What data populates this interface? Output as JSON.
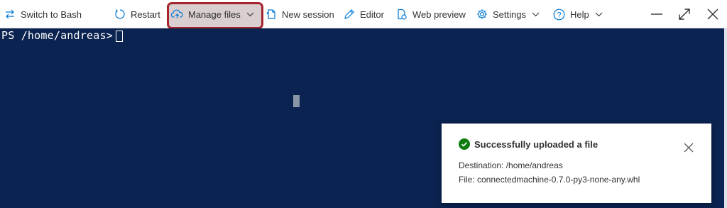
{
  "toolbar": {
    "switch_shell_label": "Switch to Bash",
    "restart_label": "Restart",
    "manage_files_label": "Manage files",
    "new_session_label": "New session",
    "editor_label": "Editor",
    "web_preview_label": "Web preview",
    "settings_label": "Settings",
    "help_label": "Help",
    "icons": {
      "switch_shell": "switch-arrows-icon",
      "restart": "restart-icon",
      "manage_files": "cloud-upload-icon",
      "new_session": "new-session-icon",
      "editor": "pencil-icon",
      "web_preview": "web-preview-icon",
      "settings": "gear-icon",
      "help": "help-circle-icon"
    },
    "icon_color": "#0078d4",
    "highlight_color": "#a4262c"
  },
  "window_controls": [
    "minimize-icon",
    "maximize-icon",
    "close-icon"
  ],
  "terminal": {
    "prompt": "PS /home/andreas>",
    "background": "#0b2350",
    "text_color": "#ffffff"
  },
  "toast": {
    "title": "Successfully uploaded a file",
    "destination": "Destination: /home/andreas",
    "file": "File: connectedmachine-0.7.0-py3-none-any.whl",
    "status_icon": "success-check-icon",
    "status_color": "#107c10"
  }
}
